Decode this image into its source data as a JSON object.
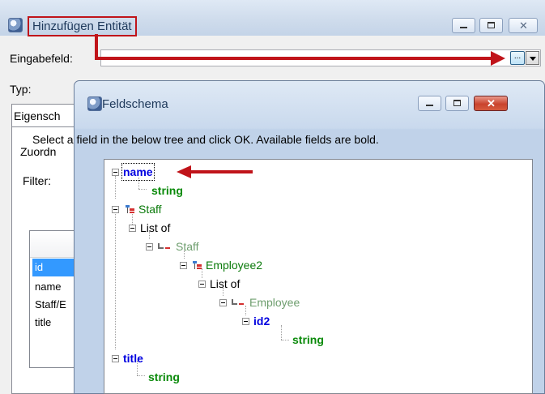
{
  "outer_window": {
    "title": "Hinzufügen Entität",
    "input_field_label": "Eingabefeld:",
    "input_field_value": "",
    "browse_button_label": "...",
    "type_label": "Typ:",
    "properties_tab_label": "Eigensch",
    "mapping_label": "Zuordn",
    "filter_label": "Filter:",
    "list_rows": [
      "id",
      "name",
      "Staff/E",
      "title"
    ],
    "selected_row": "id"
  },
  "dialog": {
    "title": "Feldschema",
    "instruction": "Select a field in the below tree and click OK. Available fields are bold.",
    "tree": {
      "name": "name",
      "name_type": "string",
      "staff": "Staff",
      "list_of_1": "List of",
      "staff_element": "Staff",
      "employee2": "Employee2",
      "list_of_2": "List of",
      "employee": "Employee",
      "id2": "id2",
      "id2_type": "string",
      "title": "title",
      "title_type": "string"
    }
  },
  "colors": {
    "annotation_red": "#c0141a",
    "available_field_blue": "#0000e0",
    "type_green": "#0a8a0a",
    "selection_blue": "#3399ff"
  },
  "icons": [
    "app-icon",
    "minimize-icon",
    "maximize-icon",
    "close-icon",
    "complex-type-icon",
    "element-icon",
    "dropdown-arrow-icon"
  ]
}
